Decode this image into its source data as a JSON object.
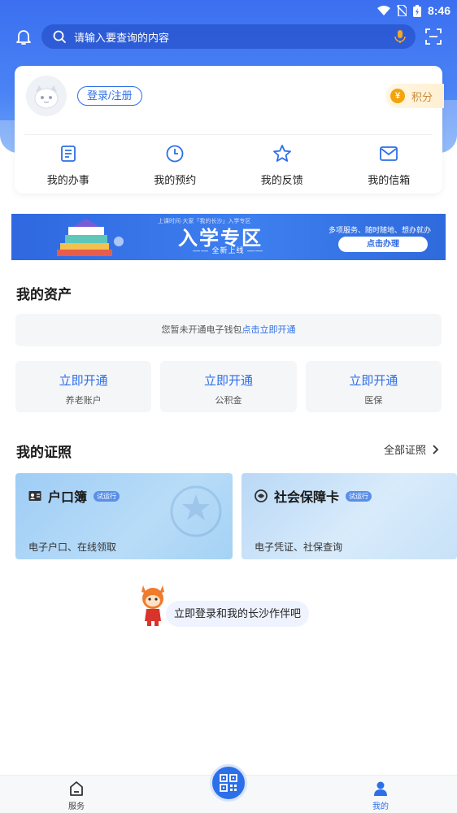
{
  "status_bar": {
    "time": "8:46"
  },
  "search": {
    "placeholder": "请输入要查询的内容"
  },
  "profile": {
    "login_label": "登录/注册",
    "points_label": "积分",
    "points_icon": "yen-coin-icon",
    "quick_actions": [
      {
        "label": "我的办事",
        "icon": "document-icon"
      },
      {
        "label": "我的预约",
        "icon": "clock-icon"
      },
      {
        "label": "我的反馈",
        "icon": "star-icon"
      },
      {
        "label": "我的信箱",
        "icon": "mail-icon"
      }
    ]
  },
  "banner": {
    "title": "入学专区",
    "subtitle": "—— 全新上线 ——",
    "tagline": "上课时间·大家「我的长沙」入学专区",
    "right_text": "多项服务、随时随地、想办就办",
    "cta": "点击办理"
  },
  "assets": {
    "title": "我的资产",
    "wallet_text": "您暂未开通电子钱包",
    "wallet_link": "点击立即开通",
    "items": [
      {
        "action": "立即开通",
        "label": "养老账户"
      },
      {
        "action": "立即开通",
        "label": "公积金"
      },
      {
        "action": "立即开通",
        "label": "医保"
      }
    ]
  },
  "certificates": {
    "title": "我的证照",
    "all_label": "全部证照",
    "items": [
      {
        "name": "户口簿",
        "badge": "试运行",
        "desc": "电子户口、在线领取"
      },
      {
        "name": "社会保障卡",
        "badge": "试运行",
        "desc": "电子凭证、社保查询"
      }
    ]
  },
  "promo": {
    "text": "立即登录和我的长沙作伴吧"
  },
  "tabbar": {
    "service_label": "服务",
    "mine_label": "我的"
  },
  "colors": {
    "primary": "#2d6fe8",
    "header": "#3b6ff0",
    "points": "#f4a30c"
  }
}
